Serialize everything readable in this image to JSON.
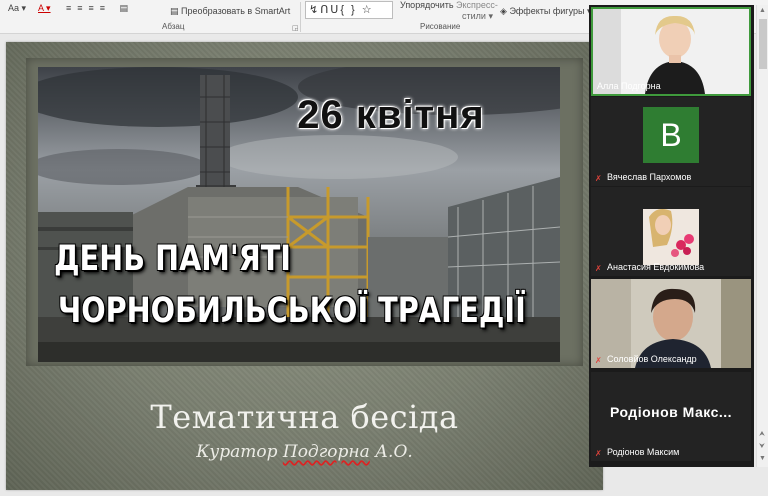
{
  "ribbon": {
    "font_size_label": "Aa",
    "font_color_label": "A",
    "smartart_label": "Преобразовать в SmartArt",
    "paragraph_group": "Абзац",
    "arrange_label": "Упорядочить",
    "express_styles_label_1": "Экспресс-",
    "express_styles_label_2": "стили",
    "shape_effects_label": "Эффекты фигуры",
    "drawing_group": "Рисование",
    "shapes_preview": "↯ᑎᑌ{ } ☆"
  },
  "slide": {
    "date_text": "26 квітня",
    "headline_line1": "ДЕНЬ ПАМ'ЯТІ",
    "headline_line2": "ЧОРНОБИЛЬСЬКОЇ ТРАГЕДІЇ",
    "title": "Тематична бесіда",
    "subtitle_prefix": "Куратор ",
    "subtitle_name": "Подгорна",
    "subtitle_suffix": " А.О."
  },
  "participants": [
    {
      "name": "Алла Подгорна",
      "muted": false,
      "active": true
    },
    {
      "name": "Вячеслав Пархомов",
      "muted": true,
      "avatar_letter": "В"
    },
    {
      "name": "Анастасия Евдокимова",
      "muted": true
    },
    {
      "name": "Соловйов Олександр",
      "muted": true
    },
    {
      "name": "Родіонов Максим",
      "muted": true,
      "display_name": "Родіонов Макс..."
    }
  ],
  "colors": {
    "active_border": "#3f9a3c",
    "avatar_bg": "#2f7d32",
    "mic_off": "#e0433b"
  }
}
